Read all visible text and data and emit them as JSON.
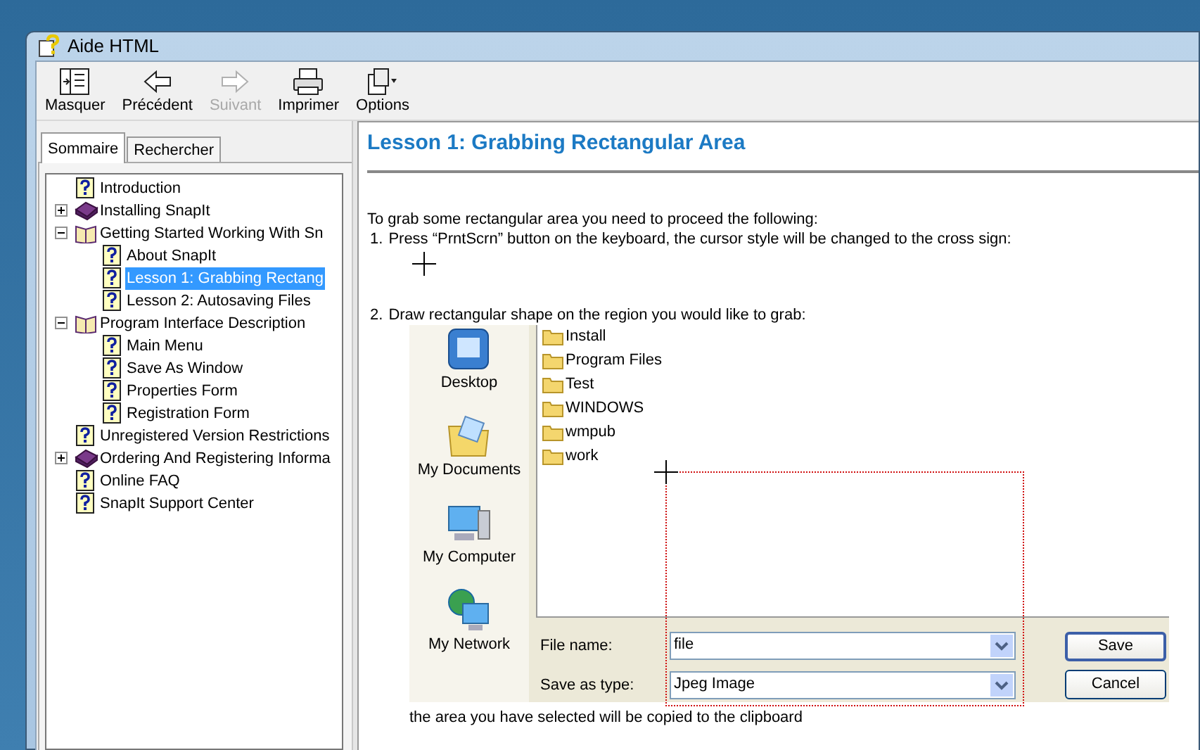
{
  "window": {
    "title": "Aide HTML"
  },
  "toolbar": [
    {
      "label": "Masquer",
      "kind": "hide",
      "disabled": false
    },
    {
      "label": "Précédent",
      "kind": "back",
      "disabled": false
    },
    {
      "label": "Suivant",
      "kind": "forward",
      "disabled": true
    },
    {
      "label": "Imprimer",
      "kind": "print",
      "disabled": false
    },
    {
      "label": "Options",
      "kind": "options",
      "disabled": false
    }
  ],
  "tabs": [
    {
      "label": "Sommaire",
      "selected": true
    },
    {
      "label": "Rechercher",
      "selected": false
    }
  ],
  "tree": [
    {
      "label": "Introduction",
      "kind": "page",
      "selected": false
    },
    {
      "label": "Installing SnapIt",
      "kind": "book",
      "expanded": false,
      "selected": false
    },
    {
      "label": "Getting Started Working With Sn",
      "kind": "book",
      "expanded": true,
      "selected": false,
      "children": [
        {
          "label": "About SnapIt",
          "kind": "page",
          "selected": false
        },
        {
          "label": "Lesson 1: Grabbing Rectang",
          "kind": "page",
          "selected": true
        },
        {
          "label": "Lesson 2: Autosaving Files",
          "kind": "page",
          "selected": false
        }
      ]
    },
    {
      "label": "Program Interface Description",
      "kind": "book",
      "expanded": true,
      "selected": false,
      "children": [
        {
          "label": "Main Menu",
          "kind": "page",
          "selected": false
        },
        {
          "label": "Save As  Window",
          "kind": "page",
          "selected": false
        },
        {
          "label": "Properties Form",
          "kind": "page",
          "selected": false
        },
        {
          "label": "Registration Form",
          "kind": "page",
          "selected": false
        }
      ]
    },
    {
      "label": "Unregistered Version Restrictions",
      "kind": "page",
      "selected": false
    },
    {
      "label": "Ordering And Registering Informa",
      "kind": "book",
      "expanded": false,
      "selected": false
    },
    {
      "label": "Online FAQ",
      "kind": "page",
      "selected": false
    },
    {
      "label": "SnapIt Support Center",
      "kind": "page",
      "selected": false
    }
  ],
  "content": {
    "heading": "Lesson 1: Grabbing Rectangular Area",
    "intro": "To grab some rectangular area you need to proceed the following:",
    "steps": [
      {
        "number": "1.",
        "text": "Press “PrntScrn” button on the keyboard, the cursor style will be changed to the cross sign:"
      },
      {
        "number": "2.",
        "text": "Draw rectangular shape on the region you would like to grab:"
      }
    ],
    "dialog": {
      "places": [
        {
          "label": "Desktop",
          "kind": "desktop"
        },
        {
          "label": "My Documents",
          "kind": "documents"
        },
        {
          "label": "My Computer",
          "kind": "computer"
        },
        {
          "label": "My Network",
          "kind": "network"
        }
      ],
      "folders": [
        "Install",
        "Program Files",
        "Test",
        "WINDOWS",
        "wmpub",
        "work"
      ],
      "fields": [
        {
          "label": "File name:",
          "value": "file"
        },
        {
          "label": "Save as type:",
          "value": "Jpeg Image"
        }
      ],
      "buttons": [
        {
          "label": "Save",
          "default": true
        },
        {
          "label": "Cancel",
          "default": false
        }
      ]
    },
    "footer": "the area you have selected will be copied to the clipboard"
  }
}
